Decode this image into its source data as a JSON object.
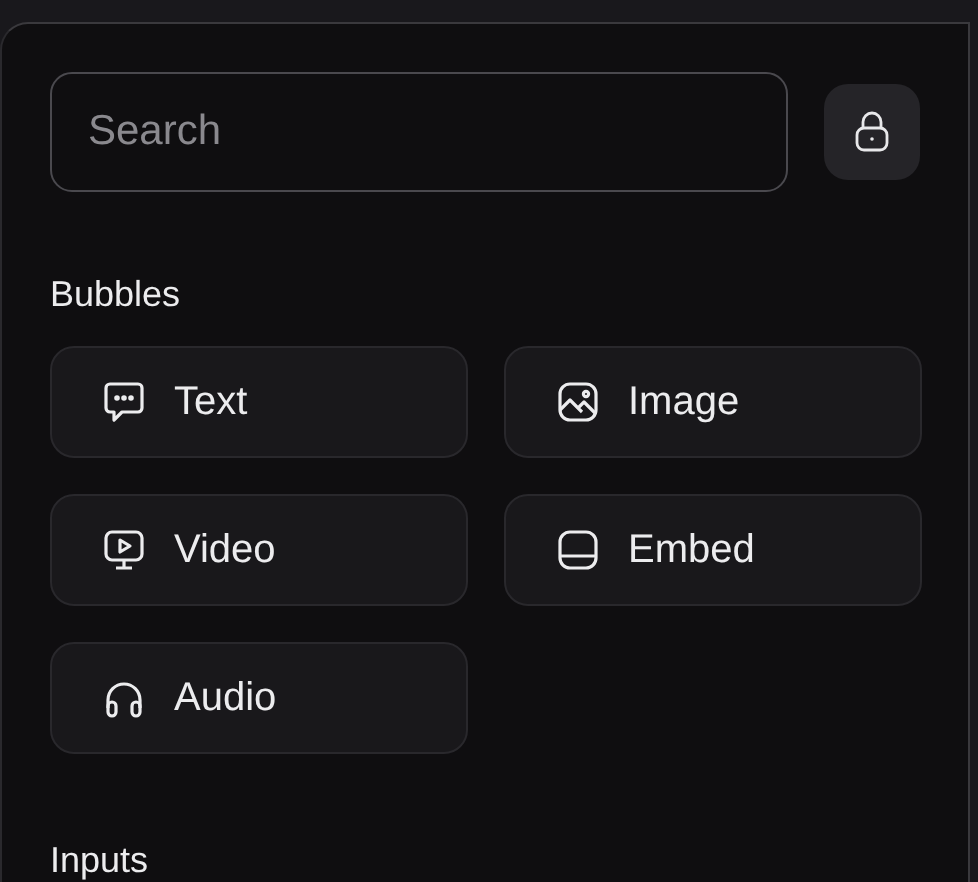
{
  "search": {
    "placeholder": "Search"
  },
  "sections": [
    {
      "title": "Bubbles",
      "items": [
        {
          "label": "Text",
          "kind": "text"
        },
        {
          "label": "Image",
          "kind": "image"
        },
        {
          "label": "Video",
          "kind": "video"
        },
        {
          "label": "Embed",
          "kind": "embed"
        },
        {
          "label": "Audio",
          "kind": "audio"
        }
      ]
    },
    {
      "title": "Inputs"
    }
  ]
}
